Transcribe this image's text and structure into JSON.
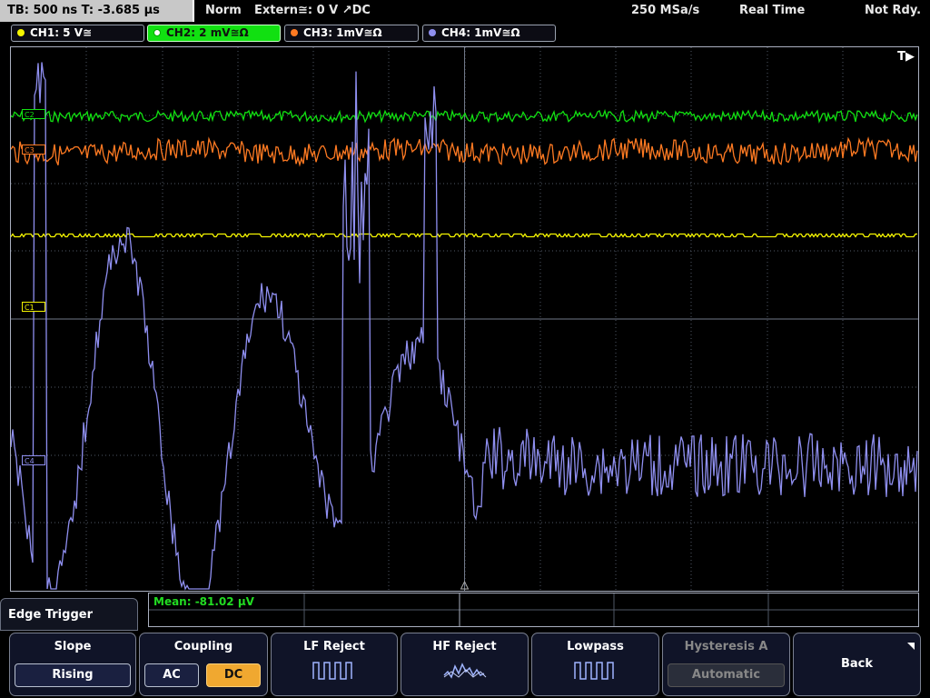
{
  "topbar": {
    "timebase": "TB: 500 ns   T: -3.685 µs",
    "mode": "Norm",
    "trigger_source": "Extern≅: 0 V ↗DC",
    "sample_rate": "250 MSa/s",
    "acq_mode": "Real Time",
    "status": "Not Rdy."
  },
  "channels": [
    {
      "label": "CH1: 5 V≅",
      "color": "#f5f500"
    },
    {
      "label": "CH2: 2 mV≅Ω",
      "color": "#11e011",
      "active": true
    },
    {
      "label": "CH3: 1mV≅Ω",
      "color": "#ff7a22"
    },
    {
      "label": "CH4: 1mV≅Ω",
      "color": "#8f8ff0"
    }
  ],
  "markers": {
    "c2": "C2",
    "c3": "C3",
    "c1": "C1",
    "c4": "C4"
  },
  "trigger_indicator": "T▶",
  "measurement": {
    "mean": "Mean: -81.02 µV"
  },
  "menu": {
    "title": "Edge Trigger",
    "slope": {
      "label": "Slope",
      "value": "Rising"
    },
    "coupling": {
      "label": "Coupling",
      "options": [
        "AC",
        "DC"
      ],
      "selected": "DC"
    },
    "lf_reject": {
      "label": "LF Reject"
    },
    "hf_reject": {
      "label": "HF Reject"
    },
    "lowpass": {
      "label": "Lowpass"
    },
    "hysteresis": {
      "label": "Hysteresis A",
      "value": "Automatic"
    },
    "back": {
      "label": "Back"
    }
  },
  "colors": {
    "ch1": "#f5f500",
    "ch2": "#11e011",
    "ch3": "#ff7a22",
    "ch4": "#8f8ff0",
    "grid": "#505866"
  }
}
